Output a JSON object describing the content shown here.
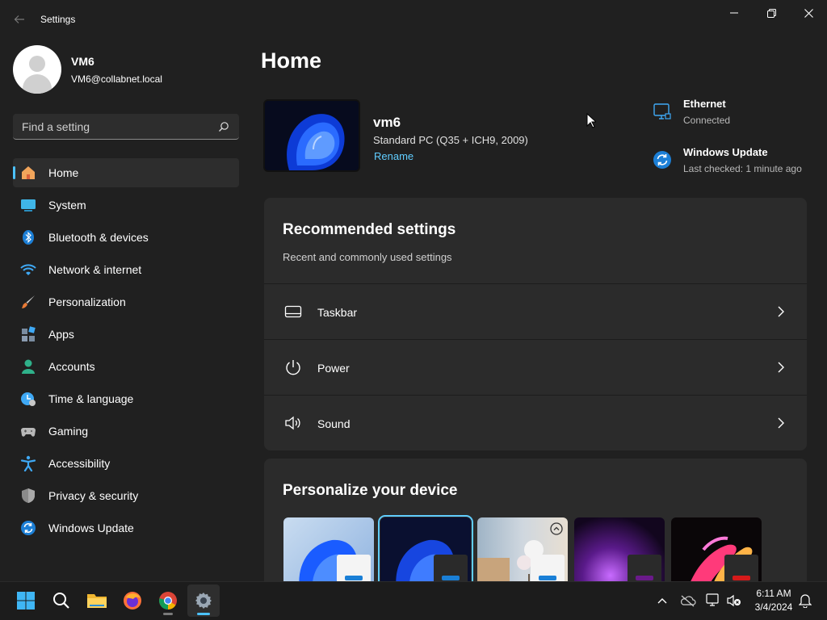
{
  "window": {
    "app_title": "Settings"
  },
  "profile": {
    "name": "VM6",
    "email": "VM6@collabnet.local"
  },
  "search": {
    "placeholder": "Find a setting"
  },
  "sidebar": {
    "items": [
      {
        "label": "Home",
        "icon": "home-icon",
        "active": true
      },
      {
        "label": "System",
        "icon": "system-icon"
      },
      {
        "label": "Bluetooth & devices",
        "icon": "bluetooth-icon"
      },
      {
        "label": "Network & internet",
        "icon": "wifi-icon"
      },
      {
        "label": "Personalization",
        "icon": "brush-icon"
      },
      {
        "label": "Apps",
        "icon": "apps-icon"
      },
      {
        "label": "Accounts",
        "icon": "accounts-icon"
      },
      {
        "label": "Time & language",
        "icon": "time-language-icon"
      },
      {
        "label": "Gaming",
        "icon": "gamepad-icon"
      },
      {
        "label": "Accessibility",
        "icon": "accessibility-icon"
      },
      {
        "label": "Privacy & security",
        "icon": "shield-icon"
      },
      {
        "label": "Windows Update",
        "icon": "update-icon"
      }
    ]
  },
  "main": {
    "title": "Home",
    "device": {
      "name": "vm6",
      "model": "Standard PC (Q35 + ICH9, 2009)",
      "rename_label": "Rename"
    },
    "status": {
      "ethernet_title": "Ethernet",
      "ethernet_sub": "Connected",
      "update_title": "Windows Update",
      "update_sub": "Last checked: 1 minute ago"
    },
    "recommended": {
      "title": "Recommended settings",
      "subtitle": "Recent and commonly used settings",
      "rows": [
        {
          "label": "Taskbar",
          "icon": "taskbar-icon"
        },
        {
          "label": "Power",
          "icon": "power-icon"
        },
        {
          "label": "Sound",
          "icon": "sound-icon"
        }
      ]
    },
    "personalize": {
      "title": "Personalize your device",
      "themes": [
        {
          "name": "windows-light-theme",
          "selected": false
        },
        {
          "name": "windows-dark-theme",
          "selected": true
        },
        {
          "name": "spotlight-theme",
          "selected": false
        },
        {
          "name": "glow-theme",
          "selected": false
        },
        {
          "name": "flow-theme",
          "selected": false
        }
      ]
    }
  },
  "taskbar": {
    "apps": [
      "start-icon",
      "search-icon",
      "file-explorer-icon",
      "firefox-icon",
      "chrome-icon",
      "settings-icon"
    ],
    "time": "6:11 AM",
    "date": "3/4/2024"
  },
  "colors": {
    "accent": "#4cc2ff",
    "link": "#60cdff",
    "background": "#202020",
    "card": "#2b2b2b"
  }
}
